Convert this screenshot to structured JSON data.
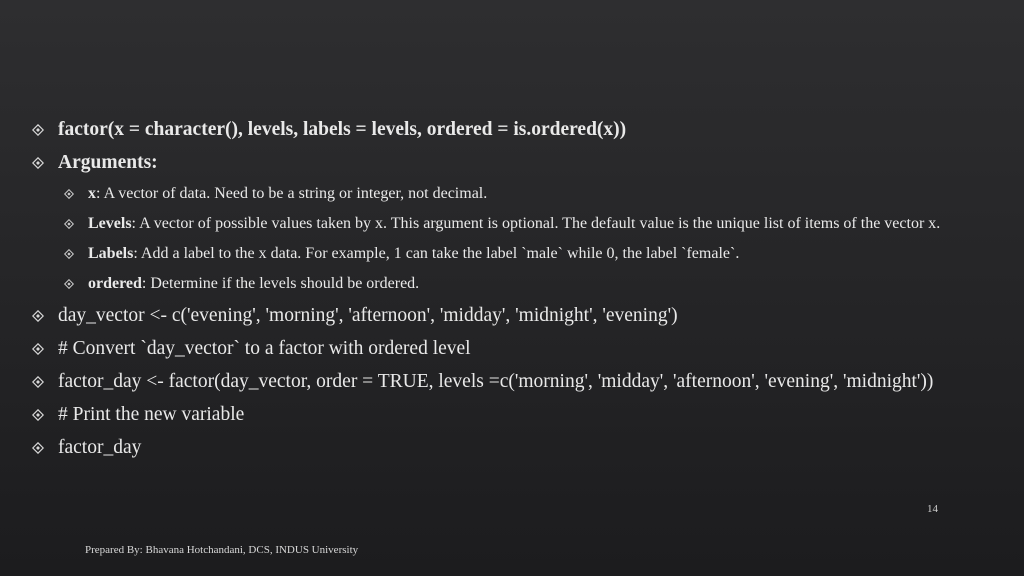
{
  "slide": {
    "items": [
      {
        "text": "factor(x = character(), levels, labels = levels, ordered = is.ordered(x))"
      },
      {
        "text": "Arguments:"
      },
      {
        "term": "x",
        "desc": ": A vector of data. Need to be a string or integer, not decimal."
      },
      {
        "term": "Levels",
        "desc": ": A vector of possible values taken by x. This argument is optional. The default value is the unique list of items of the vector x."
      },
      {
        "term": "Labels",
        "desc": ": Add a label to the x data. For example, 1 can take the label `male` while 0, the label `female`."
      },
      {
        "term": "ordered",
        "desc": ": Determine if the levels should be ordered."
      },
      {
        "text": "day_vector <- c('evening', 'morning', 'afternoon', 'midday', 'midnight', 'evening')"
      },
      {
        "text": "# Convert `day_vector` to a factor with ordered level"
      },
      {
        "text": "factor_day <- factor(day_vector, order = TRUE, levels =c('morning', 'midday', 'afternoon', 'evening', 'midnight'))"
      },
      {
        "text": "# Print the new variable"
      },
      {
        "text": "factor_day"
      }
    ],
    "bullet_icon": "diamond-dot-bullet",
    "page_number": "14",
    "footer": "Prepared By: Bhavana Hotchandani, DCS, INDUS University"
  },
  "colors": {
    "background_top": "#2e2e30",
    "background_bottom": "#1c1c1e",
    "text": "#e9e9e9"
  }
}
